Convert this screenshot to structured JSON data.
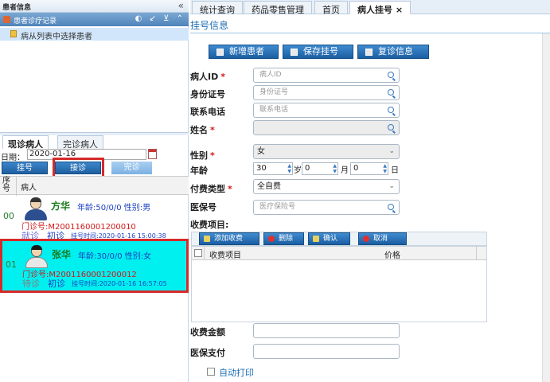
{
  "left_panel": {
    "title": "患者信息",
    "collapse_glyph": "«",
    "record_header": "患者诊疗记录",
    "record_tools": "◐ ↙ ⊻ ⌃",
    "record_item": "病从列表中选择患者",
    "tabs": [
      "现诊病人",
      "完诊病人"
    ],
    "date_label": "日期：",
    "date_value": "2020-01-16",
    "buttons": {
      "register": "挂号",
      "consult": "接诊",
      "complete": "完诊"
    },
    "grid_headers": {
      "seq": "序号",
      "patient": "病人"
    },
    "patients": [
      {
        "seq": "00",
        "name": "方华",
        "info": "年龄:50/0/0  性别:男",
        "clinic": "门诊号:M2001160001200010",
        "status": "就诊",
        "type": "初诊",
        "time": "挂号时间:2020-01-16 15:00:38"
      },
      {
        "seq": "01",
        "name": "张华",
        "info": "年龄:30/0/0  性别:女",
        "clinic": "门诊号:M2001160001200012",
        "status": "待诊",
        "type": "初诊",
        "time": "挂号时间:2020-01-16 16:57:05"
      }
    ]
  },
  "top_tabs": [
    {
      "label": "统计查询",
      "active": false
    },
    {
      "label": "药品零售管理",
      "active": false
    },
    {
      "label": "首页",
      "active": false
    },
    {
      "label": "病人挂号 ×",
      "active": true
    }
  ],
  "form": {
    "title": "挂号信息",
    "toolbar": {
      "new_patient": "新增患者",
      "save": "保存挂号",
      "revisit": "复诊信息"
    },
    "fields": {
      "patient_id": {
        "label": "病人ID",
        "required": true,
        "placeholder": "病人ID"
      },
      "id_card": {
        "label": "身份证号",
        "required": false,
        "placeholder": "身份证号"
      },
      "phone": {
        "label": "联系电话",
        "required": false,
        "placeholder": "联系电话"
      },
      "name": {
        "label": "姓名",
        "required": true,
        "placeholder": ""
      },
      "gender": {
        "label": "性别",
        "required": true,
        "value": "女"
      },
      "age": {
        "label": "年龄",
        "years": "30",
        "months": "0",
        "days": "0",
        "unit_year": "岁",
        "unit_month": "月",
        "unit_day": "日"
      },
      "pay_type": {
        "label": "付费类型",
        "required": true,
        "value": "全自费"
      },
      "insurance": {
        "label": "医保号",
        "placeholder": "医疗保险号"
      },
      "fee_items_label": "收费项目:"
    },
    "fee_toolbar": {
      "add": "添加收费",
      "delete": "删除",
      "confirm": "确认",
      "cancel": "取消"
    },
    "fee_grid_headers": {
      "item": "收费项目",
      "price": "价格"
    },
    "fee_amount_label": "收费金额",
    "insurance_pay_label": "医保支付",
    "auto_print_label": "自动打印"
  },
  "required_mark": "*"
}
